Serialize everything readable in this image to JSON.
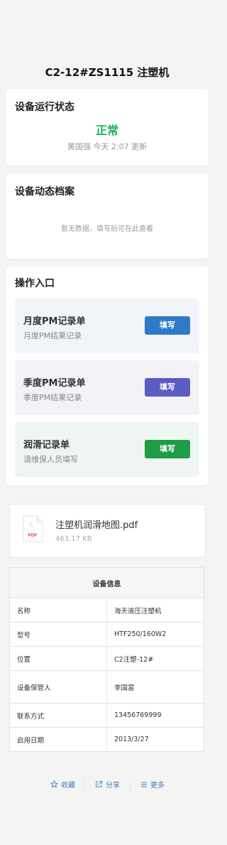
{
  "page": {
    "title": "C2-12#ZS1115 注塑机"
  },
  "status": {
    "heading": "设备运行状态",
    "value": "正常",
    "meta": "黄国强 今天 2:07 更新"
  },
  "archive": {
    "heading": "设备动态档案",
    "empty_text": "暂无数据，填写后可在此查看"
  },
  "operations": {
    "heading": "操作入口",
    "items": [
      {
        "name": "月度PM记录单",
        "desc": "月度PM结果记录",
        "button": "填写",
        "bg": "#f1f4f8",
        "button_color": "#2f7ac6"
      },
      {
        "name": "季度PM记录单",
        "desc": "季度PM结果记录",
        "button": "填写",
        "bg": "#f2f2f7",
        "button_color": "#5b5cc2"
      },
      {
        "name": "润滑记录单",
        "desc": "请维保人员填写",
        "button": "填写",
        "bg": "#eff6f1",
        "button_color": "#1e9c46"
      }
    ]
  },
  "attachment": {
    "icon_label": "PDF",
    "file_name": "注塑机润滑地图.pdf",
    "file_size": "463.17 KB"
  },
  "equipment_info": {
    "heading": "设备信息",
    "rows": [
      {
        "key": "名称",
        "value": "海天液压注塑机"
      },
      {
        "key": "型号",
        "value": "HTF250/160W2"
      },
      {
        "key": "位置",
        "value": "C2注塑-12#"
      },
      {
        "key": "设备保管人",
        "value": "李国富"
      },
      {
        "key": "联系方式",
        "value": "13456769999"
      },
      {
        "key": "启用日期",
        "value": "2013/3/27"
      }
    ]
  },
  "footer": {
    "favorite": "收藏",
    "share": "分享",
    "more": "更多"
  },
  "colors": {
    "status_ok": "#1db25a",
    "link": "#3d79c9"
  }
}
